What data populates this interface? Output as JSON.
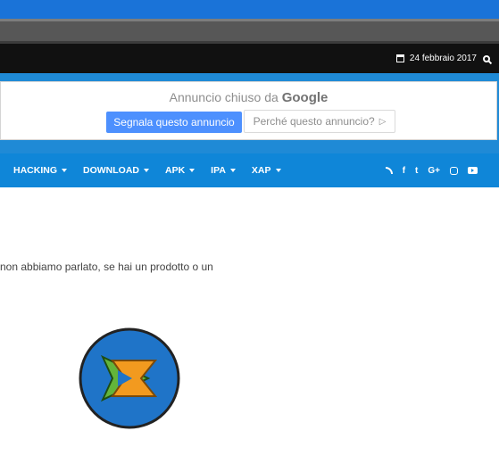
{
  "topbar": {
    "date": "24 febbraio 2017"
  },
  "ad": {
    "title_prefix": "Annuncio chiuso da ",
    "title_brand": "Google",
    "report_button": "Segnala questo annuncio",
    "why_button": "Perché questo annuncio?"
  },
  "nav": {
    "items": [
      {
        "label": "HACKING"
      },
      {
        "label": "DOWNLOAD"
      },
      {
        "label": "APK"
      },
      {
        "label": "IPA"
      },
      {
        "label": "XAP"
      }
    ],
    "social": [
      "rss-icon",
      "facebook-icon",
      "twitter-icon",
      "google-plus-icon",
      "instagram-icon",
      "youtube-icon"
    ]
  },
  "content": {
    "text": "non abbiamo parlato, se hai un prodotto o un"
  },
  "colors": {
    "nav": "#0f86d8",
    "topbar": "#111111",
    "logo_circle": "#1f74c8",
    "logo_green": "#63b53a",
    "logo_orange": "#f29a1f"
  }
}
